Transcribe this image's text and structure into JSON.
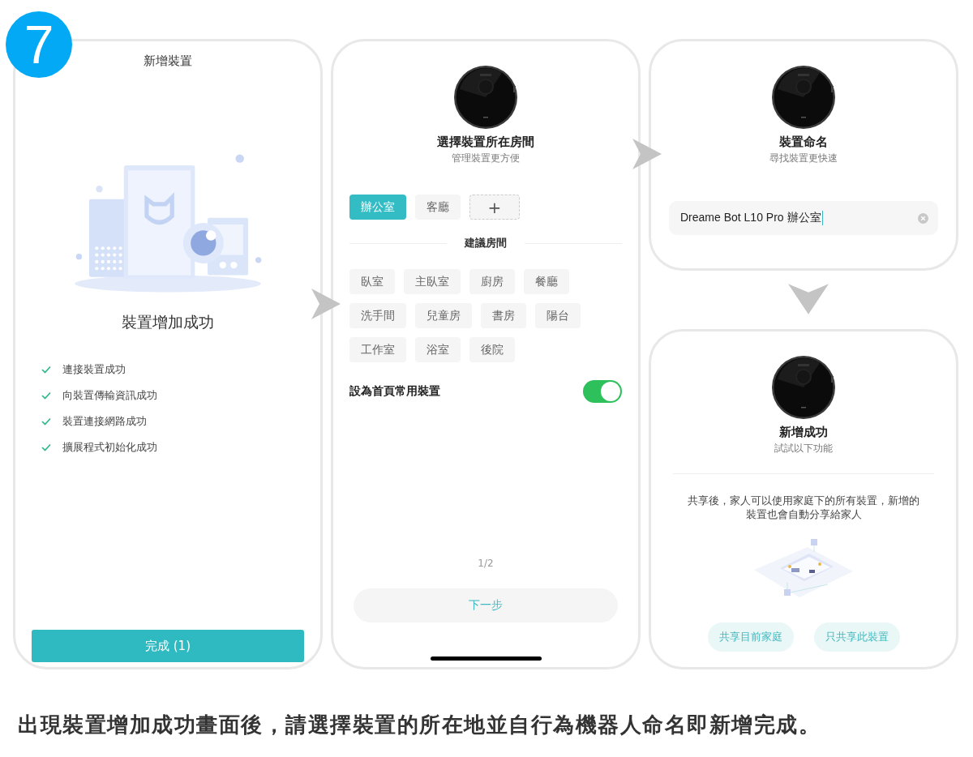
{
  "step_badge": "7",
  "add_device_screen": {
    "title": "新增裝置",
    "heading": "裝置增加成功",
    "steps": [
      {
        "label": "連接裝置成功",
        "done": true
      },
      {
        "label": "向裝置傳輸資訊成功",
        "done": true
      },
      {
        "label": "裝置連接網路成功",
        "done": true
      },
      {
        "label": "擴展程式初始化成功",
        "done": true
      }
    ],
    "done_button": "完成 (1)"
  },
  "room_screen": {
    "heading": "選擇裝置所在房間",
    "subheading": "管理裝置更方便",
    "rooms": [
      {
        "label": "辦公室",
        "selected": true
      },
      {
        "label": "客廳",
        "selected": false
      }
    ],
    "add_room": "+",
    "suggested_title": "建議房間",
    "suggested_rooms": [
      [
        "臥室",
        "主臥室",
        "廚房",
        "餐廳"
      ],
      [
        "洗手間",
        "兒童房",
        "書房",
        "陽台"
      ],
      [
        "工作室",
        "浴室",
        "後院"
      ]
    ],
    "favorite": {
      "label": "設為首頁常用裝置",
      "on": true
    },
    "page_indicator": "1/2",
    "next_button": "下一步"
  },
  "name_screen": {
    "heading": "裝置命名",
    "subheading": "尋找裝置更快速",
    "name_field": {
      "value": "Dreame Bot L10 Pro 辦公室"
    }
  },
  "success_screen": {
    "heading": "新增成功",
    "subheading": "試試以下功能",
    "description": "共享後，家人可以使用家庭下的所有裝置，新增的裝置也會自動分享給家人",
    "buttons": [
      "共享目前家庭",
      "只共享此裝置"
    ]
  },
  "caption": "出現裝置增加成功畫面後，請選擇裝置的所在地並自行為機器人命名即新增完成。"
}
